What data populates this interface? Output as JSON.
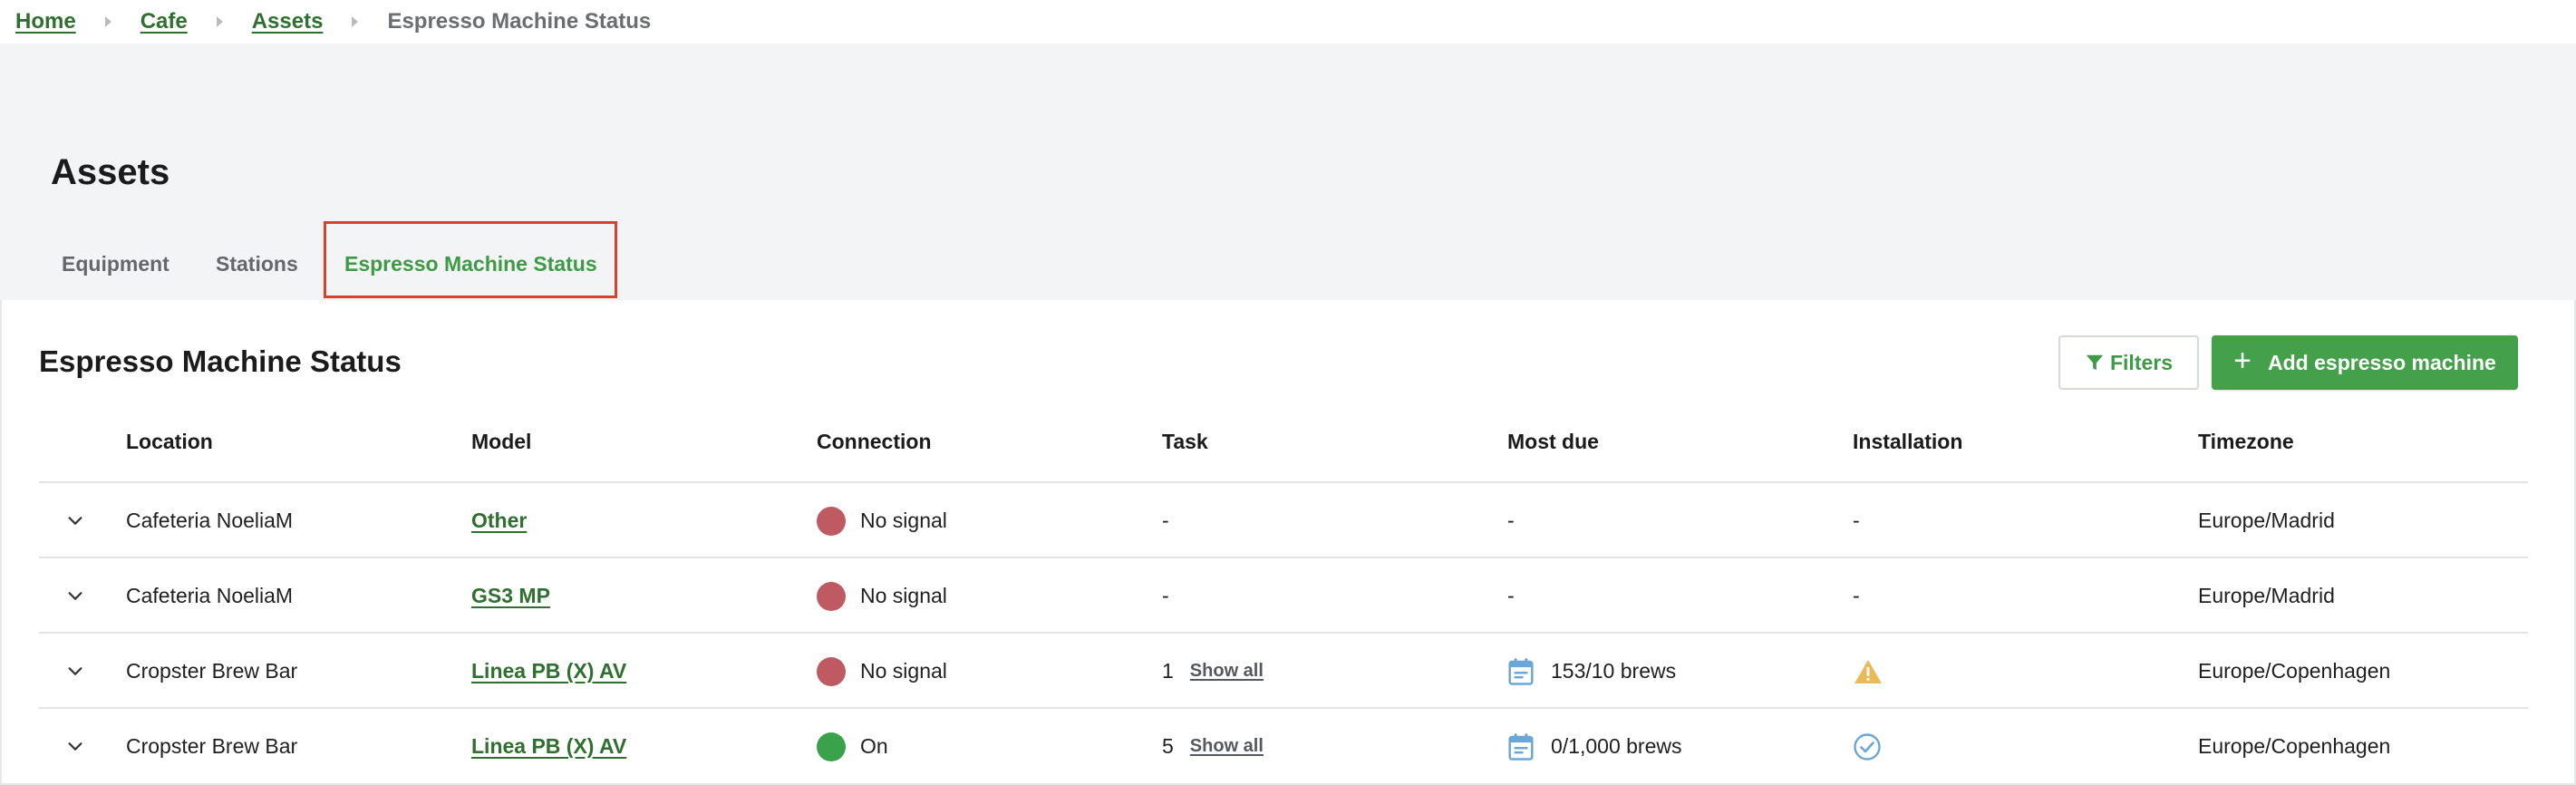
{
  "breadcrumb": {
    "items": [
      "Home",
      "Cafe",
      "Assets"
    ],
    "current": "Espresso Machine Status"
  },
  "header": {
    "title": "Assets",
    "tabs": [
      {
        "label": "Equipment",
        "active": false
      },
      {
        "label": "Stations",
        "active": false
      },
      {
        "label": "Espresso Machine Status",
        "active": true
      }
    ]
  },
  "section": {
    "title": "Espresso Machine Status",
    "filters_label": "Filters",
    "add_label": "Add espresso machine"
  },
  "table": {
    "columns": [
      "Location",
      "Model",
      "Connection",
      "Task",
      "Most due",
      "Installation",
      "Timezone"
    ],
    "rows": [
      {
        "location": "Cafeteria NoeliaM",
        "model": "Other",
        "connection": "No signal",
        "connection_status": "off",
        "task": "-",
        "show_all": "",
        "most_due": "-",
        "installation": "-",
        "installation_icon": "",
        "timezone": "Europe/Madrid"
      },
      {
        "location": "Cafeteria NoeliaM",
        "model": "GS3 MP",
        "connection": "No signal",
        "connection_status": "off",
        "task": "-",
        "show_all": "",
        "most_due": "-",
        "installation": "-",
        "installation_icon": "",
        "timezone": "Europe/Madrid"
      },
      {
        "location": "Cropster Brew Bar",
        "model": "Linea PB (X) AV",
        "connection": "No signal",
        "connection_status": "off",
        "task": "1",
        "show_all": "Show all",
        "most_due": "153/10 brews",
        "installation": "",
        "installation_icon": "warning-icon",
        "timezone": "Europe/Copenhagen"
      },
      {
        "location": "Cropster Brew Bar",
        "model": "Linea PB (X) AV",
        "connection": "On",
        "connection_status": "on",
        "task": "5",
        "show_all": "Show all",
        "most_due": "0/1,000 brews",
        "installation": "",
        "installation_icon": "check-circle-icon",
        "timezone": "Europe/Copenhagen"
      }
    ]
  },
  "colors": {
    "accent_green": "#3f9a47",
    "link_green": "#2f6f2f",
    "status_off": "#c05a62",
    "status_on": "#3aa24a",
    "warning": "#e9b95a",
    "check": "#6aa6d6",
    "highlight_box": "#d9412f"
  }
}
